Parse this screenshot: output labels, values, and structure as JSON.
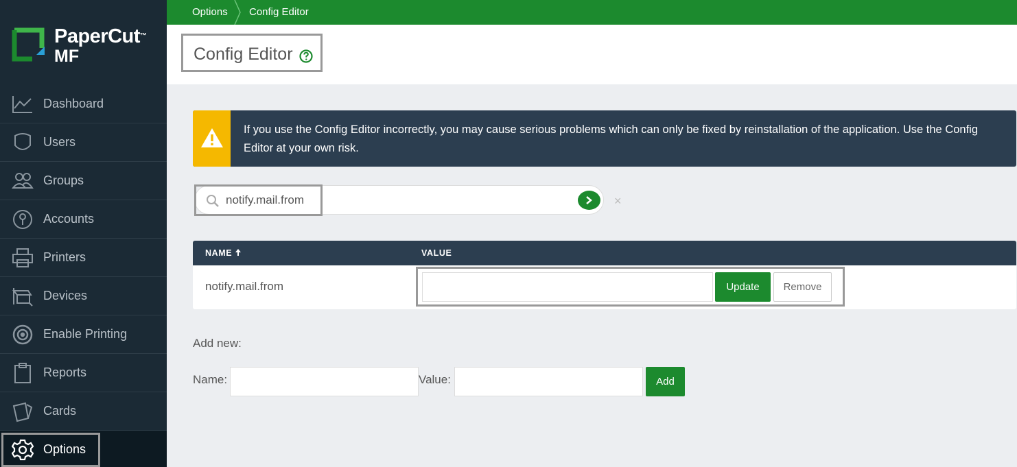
{
  "brand": {
    "name": "PaperCut",
    "tm": "™",
    "sub": "MF"
  },
  "colors": {
    "accent": "#1c8a2e",
    "sidebar": "#1b2a35",
    "warning_bg": "#2c3e50",
    "warning_icon": "#f5b800"
  },
  "nav": {
    "items": [
      {
        "label": "Dashboard",
        "icon": "chart-line-icon"
      },
      {
        "label": "Users",
        "icon": "user-icon"
      },
      {
        "label": "Groups",
        "icon": "group-icon"
      },
      {
        "label": "Accounts",
        "icon": "lock-icon"
      },
      {
        "label": "Printers",
        "icon": "printer-icon"
      },
      {
        "label": "Devices",
        "icon": "device-icon"
      },
      {
        "label": "Enable Printing",
        "icon": "enable-printing-icon"
      },
      {
        "label": "Reports",
        "icon": "clipboard-icon"
      },
      {
        "label": "Cards",
        "icon": "cards-icon"
      },
      {
        "label": "Options",
        "icon": "gear-icon",
        "active": true
      }
    ]
  },
  "breadcrumb": {
    "items": [
      "Options",
      "Config Editor"
    ]
  },
  "page": {
    "title": "Config Editor"
  },
  "warning": {
    "text": "If you use the Config Editor incorrectly, you may cause serious problems which can only be fixed by reinstallation of the application. Use the Config Editor at your own risk."
  },
  "search": {
    "value": "notify.mail.from",
    "clear": "×"
  },
  "table": {
    "columns": {
      "name": "NAME",
      "value": "VALUE"
    },
    "rows": [
      {
        "name": "notify.mail.from",
        "value": ""
      }
    ],
    "update_label": "Update",
    "remove_label": "Remove"
  },
  "add_new": {
    "heading": "Add new:",
    "name_label": "Name:",
    "value_label": "Value:",
    "add_label": "Add"
  }
}
